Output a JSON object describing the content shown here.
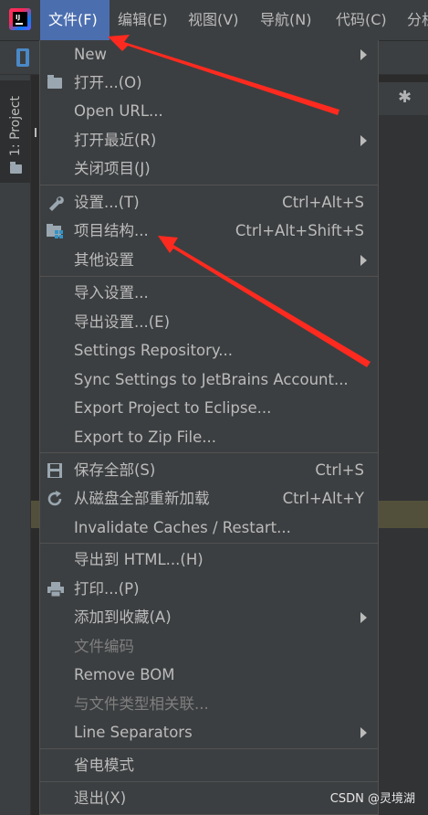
{
  "menubar": {
    "items": [
      {
        "label": "文件(F)",
        "active": true
      },
      {
        "label": "编辑(E)"
      },
      {
        "label": "视图(V)"
      },
      {
        "label": "导航(N)"
      },
      {
        "label": "代码(C)"
      },
      {
        "label": "分析"
      }
    ]
  },
  "sidebar": {
    "project_tab": "1: Project"
  },
  "file_menu": {
    "new": {
      "label": "New"
    },
    "open": {
      "label": "打开...(O)"
    },
    "open_url": {
      "label": "Open URL..."
    },
    "open_recent": {
      "label": "打开最近(R)"
    },
    "close_project": {
      "label": "关闭项目(J)"
    },
    "settings": {
      "label": "设置...(T)",
      "shortcut": "Ctrl+Alt+S"
    },
    "project_structure": {
      "label": "项目结构...",
      "shortcut": "Ctrl+Alt+Shift+S"
    },
    "other_settings": {
      "label": "其他设置"
    },
    "import_settings": {
      "label": "导入设置..."
    },
    "export_settings": {
      "label": "导出设置...(E)"
    },
    "settings_repository": {
      "label": "Settings Repository..."
    },
    "sync_settings": {
      "label": "Sync Settings to JetBrains Account..."
    },
    "export_eclipse": {
      "label": "Export Project to Eclipse..."
    },
    "export_zip": {
      "label": "Export to Zip File..."
    },
    "save_all": {
      "label": "保存全部(S)",
      "shortcut": "Ctrl+S"
    },
    "reload_disk": {
      "label": "从磁盘全部重新加载",
      "shortcut": "Ctrl+Alt+Y"
    },
    "invalidate_caches": {
      "label": "Invalidate Caches / Restart..."
    },
    "export_html": {
      "label": "导出到 HTML...(H)"
    },
    "print": {
      "label": "打印...(P)"
    },
    "add_favorites": {
      "label": "添加到收藏(A)"
    },
    "file_encoding": {
      "label": "文件编码"
    },
    "remove_bom": {
      "label": "Remove BOM"
    },
    "associate_file_type": {
      "label": "与文件类型相关联..."
    },
    "line_separators": {
      "label": "Line Separators"
    },
    "power_save": {
      "label": "省电模式"
    },
    "exit": {
      "label": "退出(X)"
    }
  },
  "watermark": "CSDN @灵境湖",
  "colors": {
    "menubar_bg": "#3c3f41",
    "active_menu": "#4b6eaf",
    "text": "#bbbbbb",
    "disabled_text": "#7f7f7f",
    "annotation_arrow": "#ff2a1f"
  }
}
